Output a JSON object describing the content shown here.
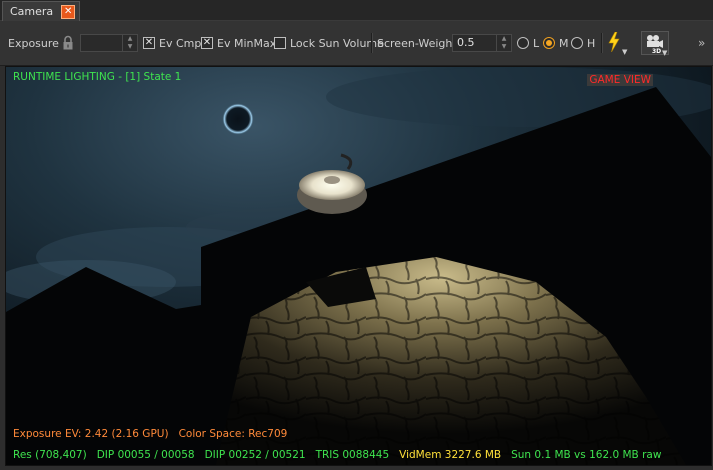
{
  "tab": {
    "title": "Camera",
    "close_icon": "close-icon"
  },
  "toolbar": {
    "exposure_label": "Exposure",
    "exposure_value": "",
    "ev_cmp_label": "Ev Cmp",
    "ev_cmp_checked": true,
    "ev_minmax_label": "Ev MinMax",
    "ev_minmax_checked": true,
    "lock_sun_label": "Lock Sun Volume",
    "lock_sun_checked": false,
    "screen_weight_label": "Screen-Weight",
    "screen_weight_value": "0.5",
    "quality_options": [
      "L",
      "M",
      "H"
    ],
    "quality_selected": "M",
    "lightning_icon": "lightning-icon",
    "camera_3d_icon": "camera-3d-icon",
    "overflow_label": "»"
  },
  "viewport": {
    "title_overlay": "RUNTIME LIGHTING - [1] State 1",
    "view_label": "GAME VIEW",
    "exposure_info": "Exposure EV: 2.42 (2.16 GPU)",
    "color_space": "Color Space: Rec709",
    "stats": {
      "res": "Res (708,407)",
      "dip": "DIP 00055 / 00058",
      "diip": "DIIP 00252 / 00521",
      "tris": "TRIS 0088445",
      "vidmem": "VidMem 3227.6 MB",
      "sun": "Sun 0.1 MB vs 162.0 MB raw"
    }
  },
  "colors": {
    "accent_orange": "#e8591c",
    "overlay_green": "#3fe44f",
    "overlay_orange": "#ff8a3a",
    "overlay_yellow": "#ffe03a",
    "overlay_red": "#ff2a2a"
  }
}
